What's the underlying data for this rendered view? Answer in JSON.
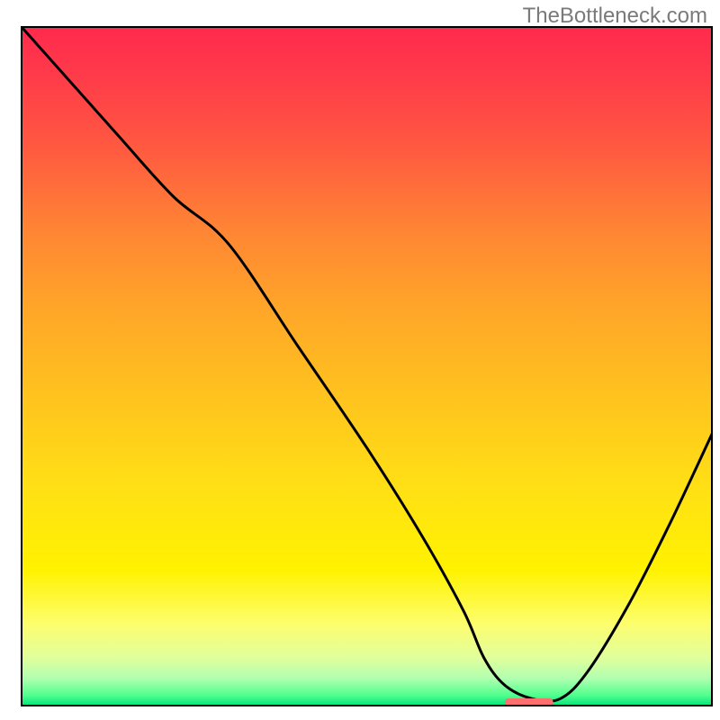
{
  "attribution": "TheBottleneck.com",
  "chart_data": {
    "type": "line",
    "title": "",
    "xlabel": "",
    "ylabel": "",
    "xlim": [
      0,
      100
    ],
    "ylim": [
      0,
      100
    ],
    "background_gradient": {
      "stops": [
        {
          "offset": 0.0,
          "color": "#ff2a4d"
        },
        {
          "offset": 0.07,
          "color": "#ff3a4a"
        },
        {
          "offset": 0.18,
          "color": "#ff5a40"
        },
        {
          "offset": 0.3,
          "color": "#ff8534"
        },
        {
          "offset": 0.42,
          "color": "#ffa728"
        },
        {
          "offset": 0.55,
          "color": "#ffc41e"
        },
        {
          "offset": 0.68,
          "color": "#ffe015"
        },
        {
          "offset": 0.8,
          "color": "#fff200"
        },
        {
          "offset": 0.88,
          "color": "#fdfe6e"
        },
        {
          "offset": 0.93,
          "color": "#e0ff9c"
        },
        {
          "offset": 0.96,
          "color": "#b0ffb0"
        },
        {
          "offset": 0.985,
          "color": "#50ff8d"
        },
        {
          "offset": 1.0,
          "color": "#00e57a"
        }
      ]
    },
    "series": [
      {
        "name": "bottleneck-curve",
        "type": "line",
        "color": "#000000",
        "x": [
          0,
          7,
          14,
          22,
          30,
          40,
          50,
          58,
          64,
          67,
          70,
          74,
          78,
          82,
          88,
          94,
          100
        ],
        "values": [
          100,
          92,
          84,
          75,
          68,
          53,
          38,
          25,
          14,
          7,
          3,
          1,
          1,
          5,
          15,
          27,
          40
        ]
      }
    ],
    "marker": {
      "name": "optimal-range",
      "color": "#ff6f6f",
      "x_start": 70.0,
      "x_end": 77.0,
      "y": 0.4
    },
    "frame": {
      "x0": 24,
      "y0": 30,
      "x1": 791,
      "y1": 784,
      "stroke": "#000000",
      "stroke_width": 2
    }
  }
}
